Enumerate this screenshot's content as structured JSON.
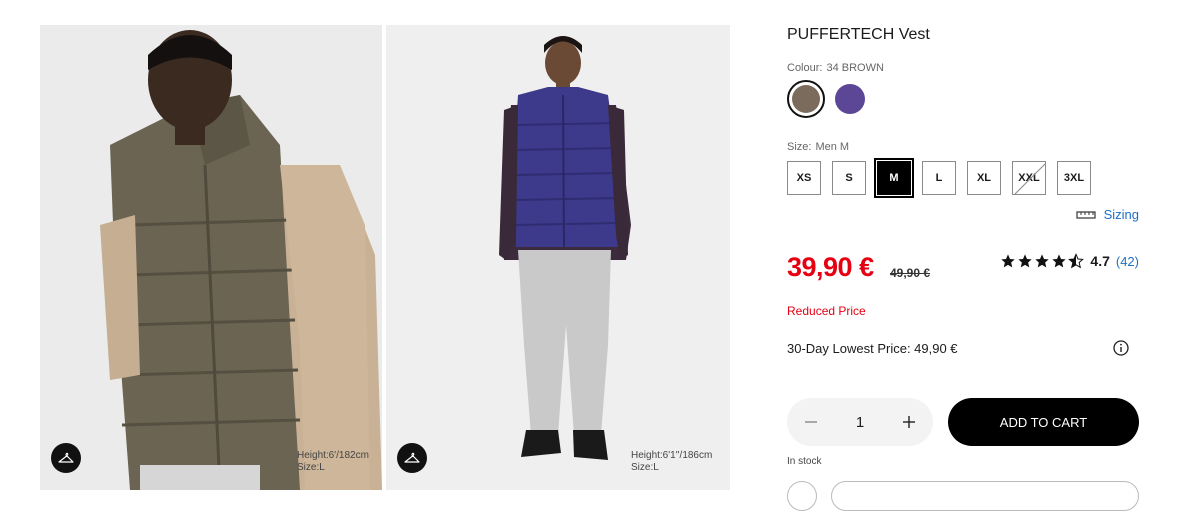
{
  "gallery": {
    "images": [
      {
        "alt": "Model wearing brown puffer vest",
        "height_label": "Height:6'/182cm",
        "size_label": "Size:L",
        "hanger_icon": "hanger-icon"
      },
      {
        "alt": "Model wearing purple puffer vest",
        "height_label": "Height:6'1''/186cm",
        "size_label": "Size:L",
        "hanger_icon": "hanger-icon"
      }
    ]
  },
  "product": {
    "title": "PUFFERTECH Vest",
    "colour": {
      "label": "Colour:",
      "value": "34 BROWN"
    },
    "swatches": [
      {
        "name": "brown",
        "color": "#7b6b5c",
        "selected": true
      },
      {
        "name": "purple",
        "color": "#5c4796",
        "selected": false
      }
    ],
    "size": {
      "label": "Size:",
      "value": "Men M"
    },
    "sizes": [
      {
        "label": "XS",
        "state": "available"
      },
      {
        "label": "S",
        "state": "available"
      },
      {
        "label": "M",
        "state": "selected"
      },
      {
        "label": "L",
        "state": "available"
      },
      {
        "label": "XL",
        "state": "available"
      },
      {
        "label": "XXL",
        "state": "out-of-stock"
      },
      {
        "label": "3XL",
        "state": "available"
      }
    ],
    "sizing_link": "Sizing",
    "price": "39,90 €",
    "original_price": "49,90 €",
    "rating": {
      "value": "4.7",
      "count": "(42)",
      "stars": 4.5
    },
    "reduced_label": "Reduced Price",
    "lowest_price": "30-Day Lowest Price: 49,90 €",
    "quantity": {
      "value": "1",
      "minus_icon": "minus-icon",
      "plus_icon": "plus-icon"
    },
    "add_to_cart": "ADD TO CART",
    "stock": "In stock"
  },
  "colors": {
    "sale_red": "#e60012",
    "link_blue": "#1e6fc3",
    "button_black": "#000000"
  }
}
